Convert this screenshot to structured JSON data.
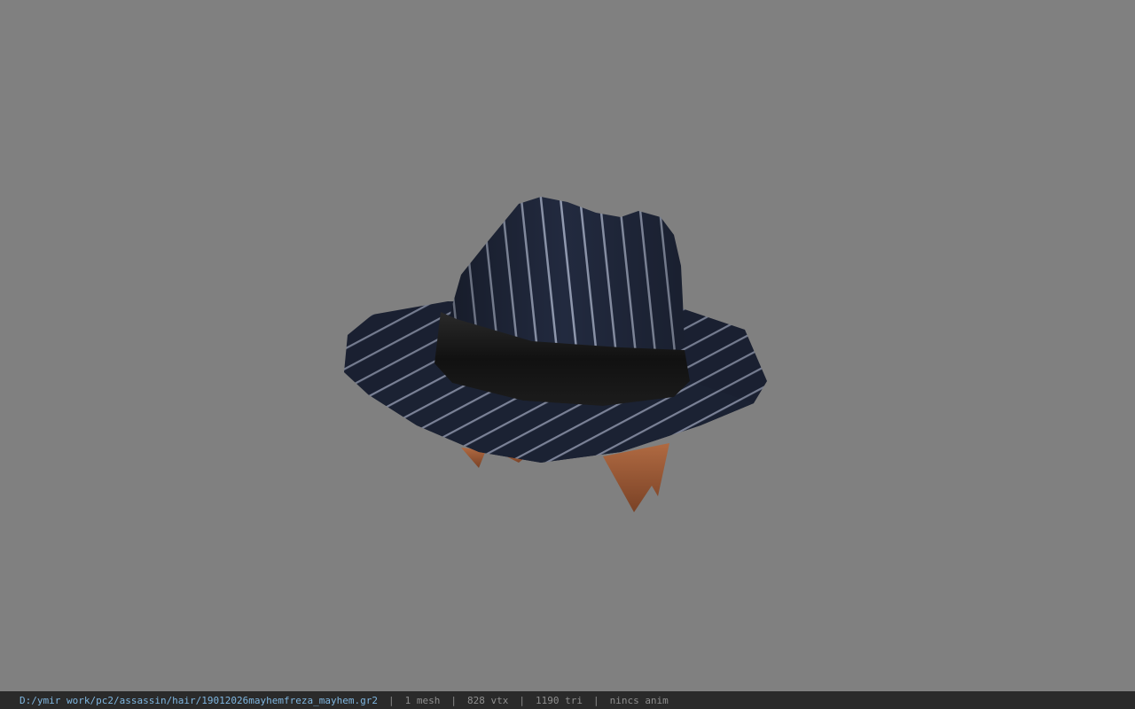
{
  "viewer": {
    "background_color": "#808080",
    "model": {
      "subject": "pinstripe-fedora-hat-with-hair",
      "hat_color": "#1f2638",
      "stripe_color": "#9aa3b8",
      "band_color": "#141414",
      "hair_color": "#9a5a38"
    }
  },
  "status_bar": {
    "file_path": "D:/ymir work/pc2/assassin/hair/19012026mayhemfreza_mayhem.gr2",
    "separator": "|",
    "mesh_count": "1 mesh",
    "vertex_count": "828 vtx",
    "triangle_count": "1190 tri",
    "anim_status": "nincs anim"
  }
}
